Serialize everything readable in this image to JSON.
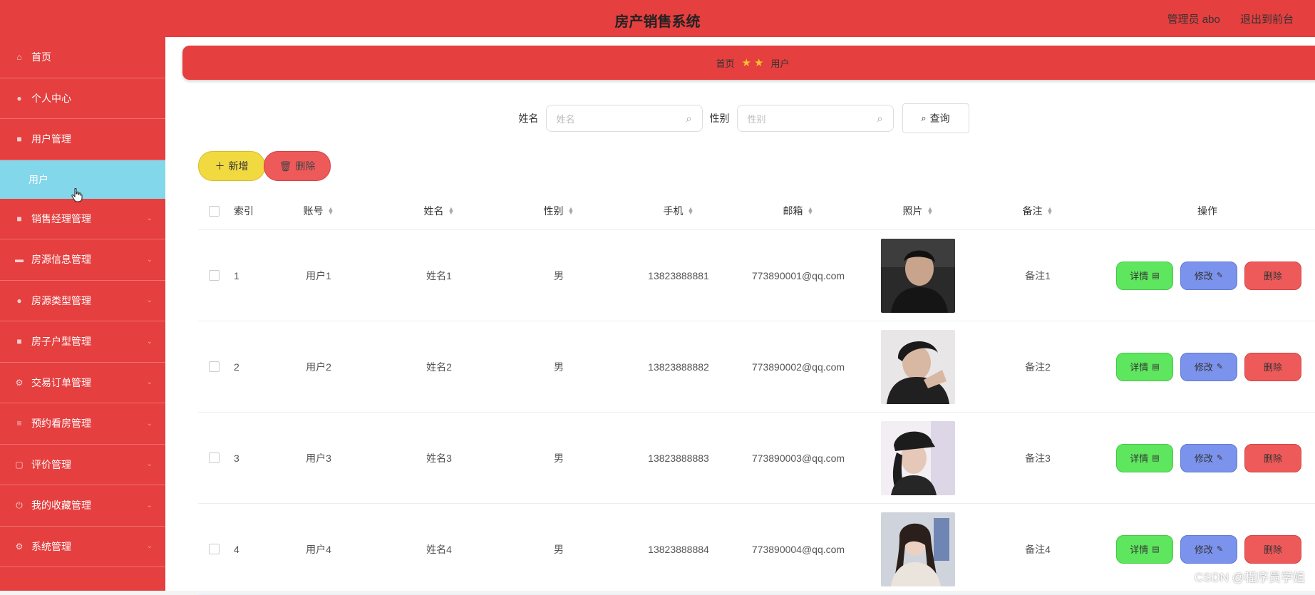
{
  "header": {
    "title": "房产销售系统",
    "user_label": "管理员 abo",
    "back_label": "退出到前台"
  },
  "sidebar": {
    "items": [
      {
        "label": "首页",
        "icon": "home-icon"
      },
      {
        "label": "个人中心",
        "icon": "user-icon"
      },
      {
        "label": "用户管理",
        "icon": "grid-icon"
      },
      {
        "label": "销售经理管理",
        "icon": "grid-icon"
      },
      {
        "label": "房源信息管理",
        "icon": "card-icon"
      },
      {
        "label": "房源类型管理",
        "icon": "user-icon"
      },
      {
        "label": "房子户型管理",
        "icon": "grid-icon"
      },
      {
        "label": "交易订单管理",
        "icon": "gear-icon"
      },
      {
        "label": "预约看房管理",
        "icon": "list-icon"
      },
      {
        "label": "评价管理",
        "icon": "chat-icon"
      },
      {
        "label": "我的收藏管理",
        "icon": "power-icon"
      },
      {
        "label": "系统管理",
        "icon": "gear-icon"
      }
    ],
    "active_sub": "用户"
  },
  "breadcrumb": {
    "home": "首页",
    "current": "用户"
  },
  "search": {
    "name_label": "姓名",
    "name_placeholder": "姓名",
    "sex_label": "性别",
    "sex_placeholder": "性别",
    "query_label": "查询"
  },
  "actions": {
    "add_label": "新增",
    "delete_label": "删除"
  },
  "table": {
    "headers": {
      "index": "索引",
      "account": "账号",
      "name": "姓名",
      "sex": "性别",
      "phone": "手机",
      "email": "邮箱",
      "photo": "照片",
      "note": "备注",
      "ops": "操作"
    },
    "op_labels": {
      "detail": "详情",
      "edit": "修改",
      "delete": "删除"
    },
    "rows": [
      {
        "index": "1",
        "account": "用户1",
        "name": "姓名1",
        "sex": "男",
        "phone": "13823888881",
        "email": "773890001@qq.com",
        "note": "备注1"
      },
      {
        "index": "2",
        "account": "用户2",
        "name": "姓名2",
        "sex": "男",
        "phone": "13823888882",
        "email": "773890002@qq.com",
        "note": "备注2"
      },
      {
        "index": "3",
        "account": "用户3",
        "name": "姓名3",
        "sex": "男",
        "phone": "13823888883",
        "email": "773890003@qq.com",
        "note": "备注3"
      },
      {
        "index": "4",
        "account": "用户4",
        "name": "姓名4",
        "sex": "男",
        "phone": "13823888884",
        "email": "773890004@qq.com",
        "note": "备注4"
      }
    ]
  },
  "watermark": "CSDN @程序员学姐",
  "colors": {
    "primary": "#e53f3f",
    "submenu_active": "#82d7ea",
    "add_button": "#f1d940",
    "detail_button": "#5fe65f",
    "edit_button": "#7b93ec",
    "delete_button": "#ee5a5a"
  }
}
